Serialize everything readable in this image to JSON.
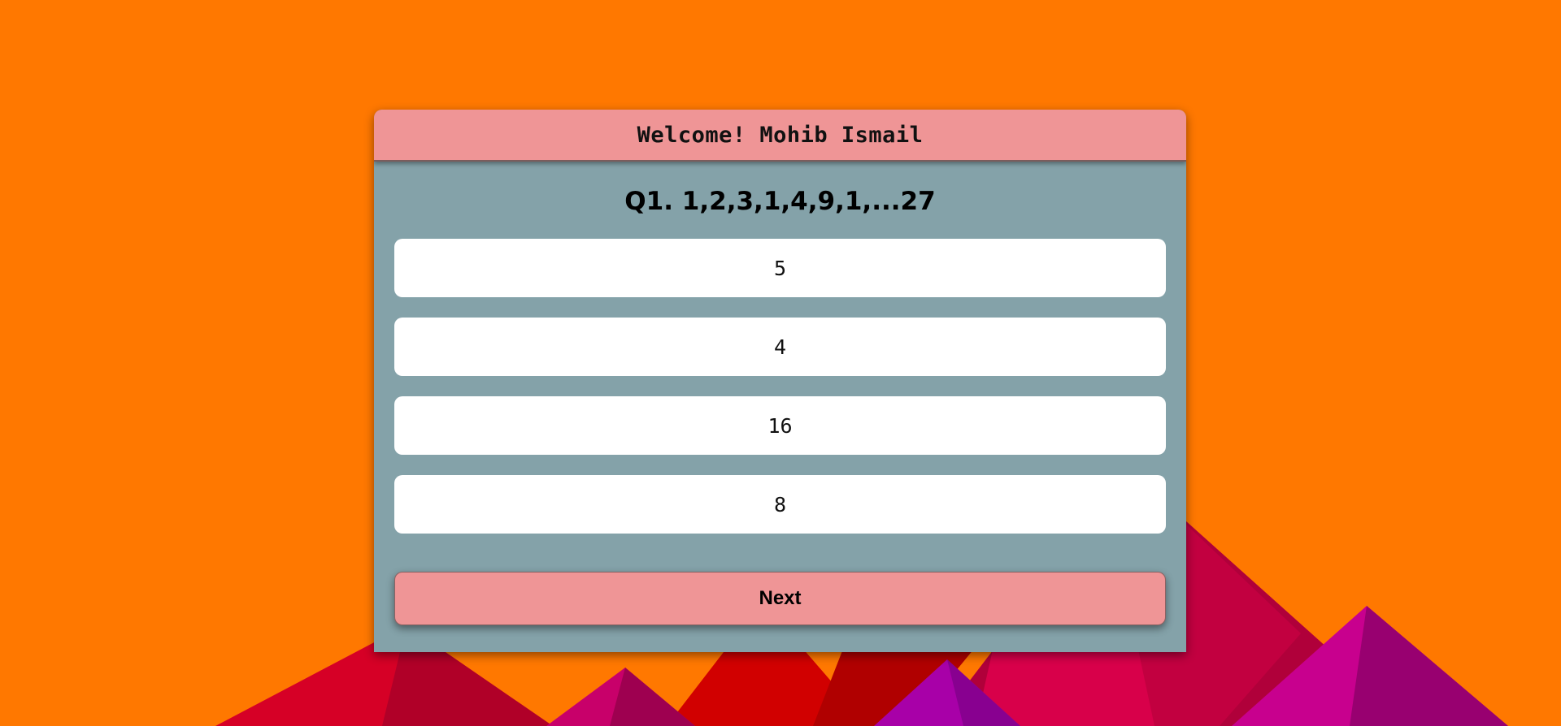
{
  "header": {
    "welcome_text": "Welcome! Mohib Ismail"
  },
  "question": {
    "text": "Q1. 1,2,3,1,4,9,1,...27"
  },
  "options": [
    {
      "label": "5"
    },
    {
      "label": "4"
    },
    {
      "label": "16"
    },
    {
      "label": "8"
    }
  ],
  "actions": {
    "next_label": "Next"
  },
  "colors": {
    "page_background": "#ff7800",
    "card_background": "#84a2a9",
    "header_background": "#ef9596",
    "option_background": "#ffffff",
    "next_button_background": "#ef9596"
  }
}
